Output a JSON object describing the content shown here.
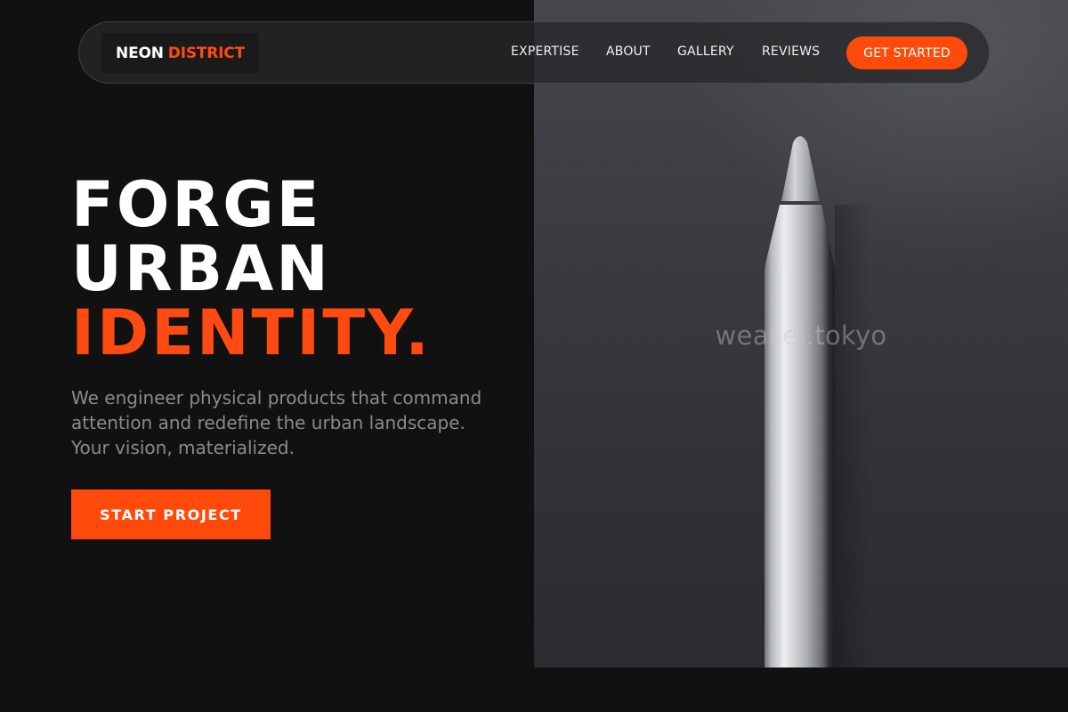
{
  "brand": {
    "name_part1": "NEON",
    "name_part2": "DISTRICT",
    "accent_color": "#ff4a0c"
  },
  "nav": {
    "links": [
      "EXPERTISE",
      "ABOUT",
      "GALLERY",
      "REVIEWS"
    ],
    "cta_label": "GET STARTED"
  },
  "hero": {
    "headline_line1": "FORGE",
    "headline_line2": "URBAN",
    "headline_line3": "IDENTITY.",
    "subtext": "We engineer physical products that command attention and redefine the urban landscape. Your vision, materialized.",
    "cta_label": "START PROJECT",
    "image": {
      "subject": "white stylus pen",
      "watermark": "weasel.tokyo"
    }
  }
}
